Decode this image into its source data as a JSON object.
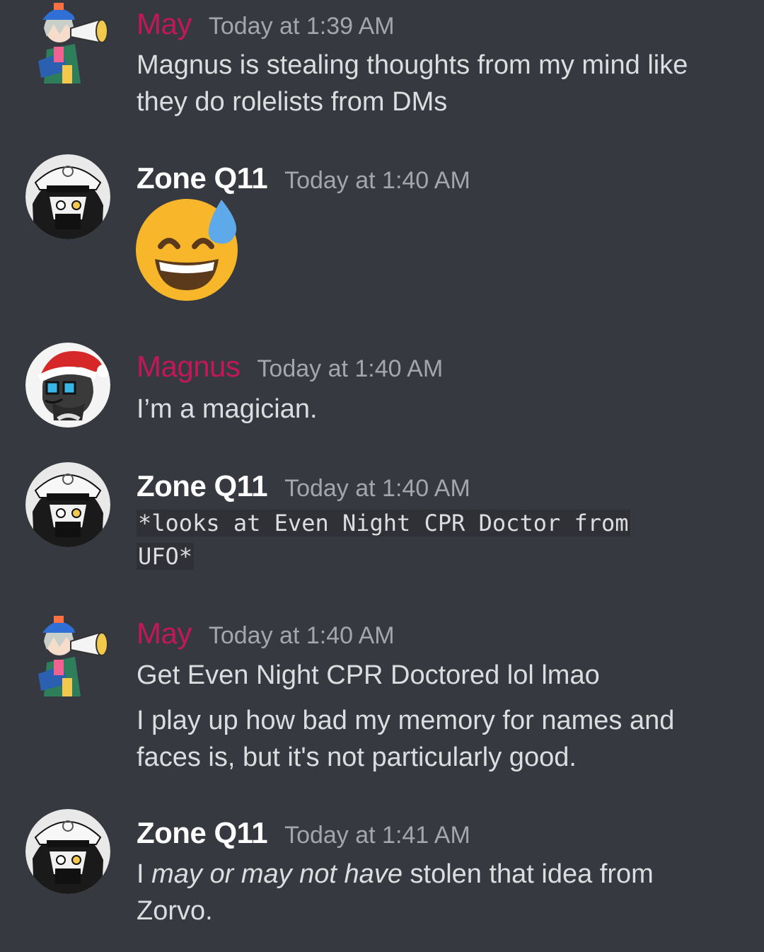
{
  "colors": {
    "background": "#36393f",
    "username_pink": "#c2185b",
    "username_white": "#ffffff",
    "timestamp": "#a3a6aa",
    "message_text": "#dcddde",
    "code_background": "#2f3136"
  },
  "messages": [
    {
      "author": "May",
      "timestamp": "Today at 1:39 AM",
      "avatar": "may-avatar",
      "lines": [
        "Magnus is stealing thoughts from my mind like they do rolelists from DMs"
      ]
    },
    {
      "author": "Zone Q11",
      "timestamp": "Today at 1:40 AM",
      "avatar": "zone-avatar",
      "emoji": "grinning-face-with-sweat-emoji"
    },
    {
      "author": "Magnus",
      "timestamp": "Today at 1:40 AM",
      "avatar": "magnus-avatar",
      "lines": [
        "I’m a magician."
      ]
    },
    {
      "author": "Zone Q11",
      "timestamp": "Today at 1:40 AM",
      "avatar": "zone-avatar",
      "code": "*looks at Even Night CPR Doctor from UFO*"
    },
    {
      "author": "May",
      "timestamp": "Today at 1:40 AM",
      "avatar": "may-avatar",
      "lines": [
        "Get Even Night CPR Doctored lol lmao",
        "I play up how bad my memory for names and faces is, but it's not particularly good."
      ]
    },
    {
      "author": "Zone Q11",
      "timestamp": "Today at 1:41 AM",
      "avatar": "zone-avatar",
      "rich": {
        "prefix": "I ",
        "italic": "may or may not have",
        "suffix": " stolen that idea from Zorvo."
      }
    }
  ]
}
